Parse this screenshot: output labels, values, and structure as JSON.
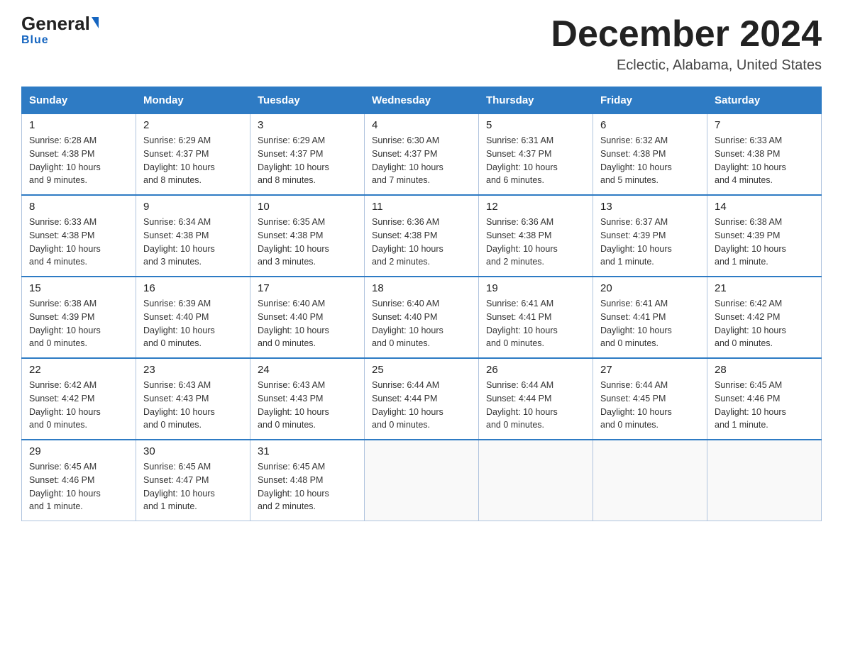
{
  "header": {
    "logo_general": "General",
    "logo_blue": "Blue",
    "month_title": "December 2024",
    "location": "Eclectic, Alabama, United States"
  },
  "weekdays": [
    "Sunday",
    "Monday",
    "Tuesday",
    "Wednesday",
    "Thursday",
    "Friday",
    "Saturday"
  ],
  "weeks": [
    [
      {
        "day": "1",
        "sunrise": "6:28 AM",
        "sunset": "4:38 PM",
        "daylight": "10 hours and 9 minutes."
      },
      {
        "day": "2",
        "sunrise": "6:29 AM",
        "sunset": "4:37 PM",
        "daylight": "10 hours and 8 minutes."
      },
      {
        "day": "3",
        "sunrise": "6:29 AM",
        "sunset": "4:37 PM",
        "daylight": "10 hours and 8 minutes."
      },
      {
        "day": "4",
        "sunrise": "6:30 AM",
        "sunset": "4:37 PM",
        "daylight": "10 hours and 7 minutes."
      },
      {
        "day": "5",
        "sunrise": "6:31 AM",
        "sunset": "4:37 PM",
        "daylight": "10 hours and 6 minutes."
      },
      {
        "day": "6",
        "sunrise": "6:32 AM",
        "sunset": "4:38 PM",
        "daylight": "10 hours and 5 minutes."
      },
      {
        "day": "7",
        "sunrise": "6:33 AM",
        "sunset": "4:38 PM",
        "daylight": "10 hours and 4 minutes."
      }
    ],
    [
      {
        "day": "8",
        "sunrise": "6:33 AM",
        "sunset": "4:38 PM",
        "daylight": "10 hours and 4 minutes."
      },
      {
        "day": "9",
        "sunrise": "6:34 AM",
        "sunset": "4:38 PM",
        "daylight": "10 hours and 3 minutes."
      },
      {
        "day": "10",
        "sunrise": "6:35 AM",
        "sunset": "4:38 PM",
        "daylight": "10 hours and 3 minutes."
      },
      {
        "day": "11",
        "sunrise": "6:36 AM",
        "sunset": "4:38 PM",
        "daylight": "10 hours and 2 minutes."
      },
      {
        "day": "12",
        "sunrise": "6:36 AM",
        "sunset": "4:38 PM",
        "daylight": "10 hours and 2 minutes."
      },
      {
        "day": "13",
        "sunrise": "6:37 AM",
        "sunset": "4:39 PM",
        "daylight": "10 hours and 1 minute."
      },
      {
        "day": "14",
        "sunrise": "6:38 AM",
        "sunset": "4:39 PM",
        "daylight": "10 hours and 1 minute."
      }
    ],
    [
      {
        "day": "15",
        "sunrise": "6:38 AM",
        "sunset": "4:39 PM",
        "daylight": "10 hours and 0 minutes."
      },
      {
        "day": "16",
        "sunrise": "6:39 AM",
        "sunset": "4:40 PM",
        "daylight": "10 hours and 0 minutes."
      },
      {
        "day": "17",
        "sunrise": "6:40 AM",
        "sunset": "4:40 PM",
        "daylight": "10 hours and 0 minutes."
      },
      {
        "day": "18",
        "sunrise": "6:40 AM",
        "sunset": "4:40 PM",
        "daylight": "10 hours and 0 minutes."
      },
      {
        "day": "19",
        "sunrise": "6:41 AM",
        "sunset": "4:41 PM",
        "daylight": "10 hours and 0 minutes."
      },
      {
        "day": "20",
        "sunrise": "6:41 AM",
        "sunset": "4:41 PM",
        "daylight": "10 hours and 0 minutes."
      },
      {
        "day": "21",
        "sunrise": "6:42 AM",
        "sunset": "4:42 PM",
        "daylight": "10 hours and 0 minutes."
      }
    ],
    [
      {
        "day": "22",
        "sunrise": "6:42 AM",
        "sunset": "4:42 PM",
        "daylight": "10 hours and 0 minutes."
      },
      {
        "day": "23",
        "sunrise": "6:43 AM",
        "sunset": "4:43 PM",
        "daylight": "10 hours and 0 minutes."
      },
      {
        "day": "24",
        "sunrise": "6:43 AM",
        "sunset": "4:43 PM",
        "daylight": "10 hours and 0 minutes."
      },
      {
        "day": "25",
        "sunrise": "6:44 AM",
        "sunset": "4:44 PM",
        "daylight": "10 hours and 0 minutes."
      },
      {
        "day": "26",
        "sunrise": "6:44 AM",
        "sunset": "4:44 PM",
        "daylight": "10 hours and 0 minutes."
      },
      {
        "day": "27",
        "sunrise": "6:44 AM",
        "sunset": "4:45 PM",
        "daylight": "10 hours and 0 minutes."
      },
      {
        "day": "28",
        "sunrise": "6:45 AM",
        "sunset": "4:46 PM",
        "daylight": "10 hours and 1 minute."
      }
    ],
    [
      {
        "day": "29",
        "sunrise": "6:45 AM",
        "sunset": "4:46 PM",
        "daylight": "10 hours and 1 minute."
      },
      {
        "day": "30",
        "sunrise": "6:45 AM",
        "sunset": "4:47 PM",
        "daylight": "10 hours and 1 minute."
      },
      {
        "day": "31",
        "sunrise": "6:45 AM",
        "sunset": "4:48 PM",
        "daylight": "10 hours and 2 minutes."
      },
      null,
      null,
      null,
      null
    ]
  ],
  "labels": {
    "sunrise": "Sunrise:",
    "sunset": "Sunset:",
    "daylight": "Daylight:"
  }
}
